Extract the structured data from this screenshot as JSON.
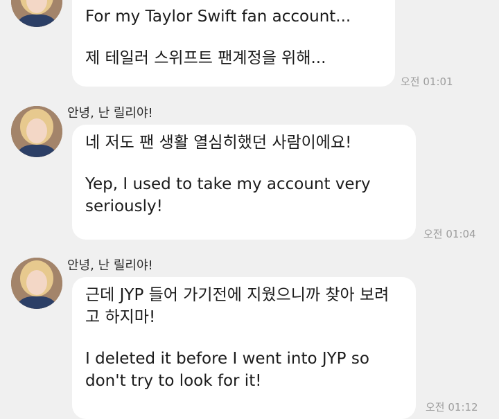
{
  "chat": {
    "messages": [
      {
        "sender": "",
        "paragraphs": [
          "For my Taylor Swift fan account...",
          "제 테일러 스위프트 팬계정을 위해..."
        ],
        "time": "오전 01:01"
      },
      {
        "sender": "안녕, 난 릴리야!",
        "paragraphs": [
          "네 저도 팬 생활 열심히했던 사람이에요!",
          "Yep, I used to take my account very seriously!"
        ],
        "time": "오전 01:04"
      },
      {
        "sender": "안녕, 난 릴리야!",
        "paragraphs": [
          "근데 JYP 들어 가기전에 지웠으니까 찾아 보려고 하지마!",
          "I deleted it before I went into JYP so don't try to look for it!"
        ],
        "time": "오전 01:12"
      }
    ]
  },
  "colors": {
    "background": "#f0f0f0",
    "bubble": "#ffffff",
    "timestamp": "#9d9d9d"
  }
}
